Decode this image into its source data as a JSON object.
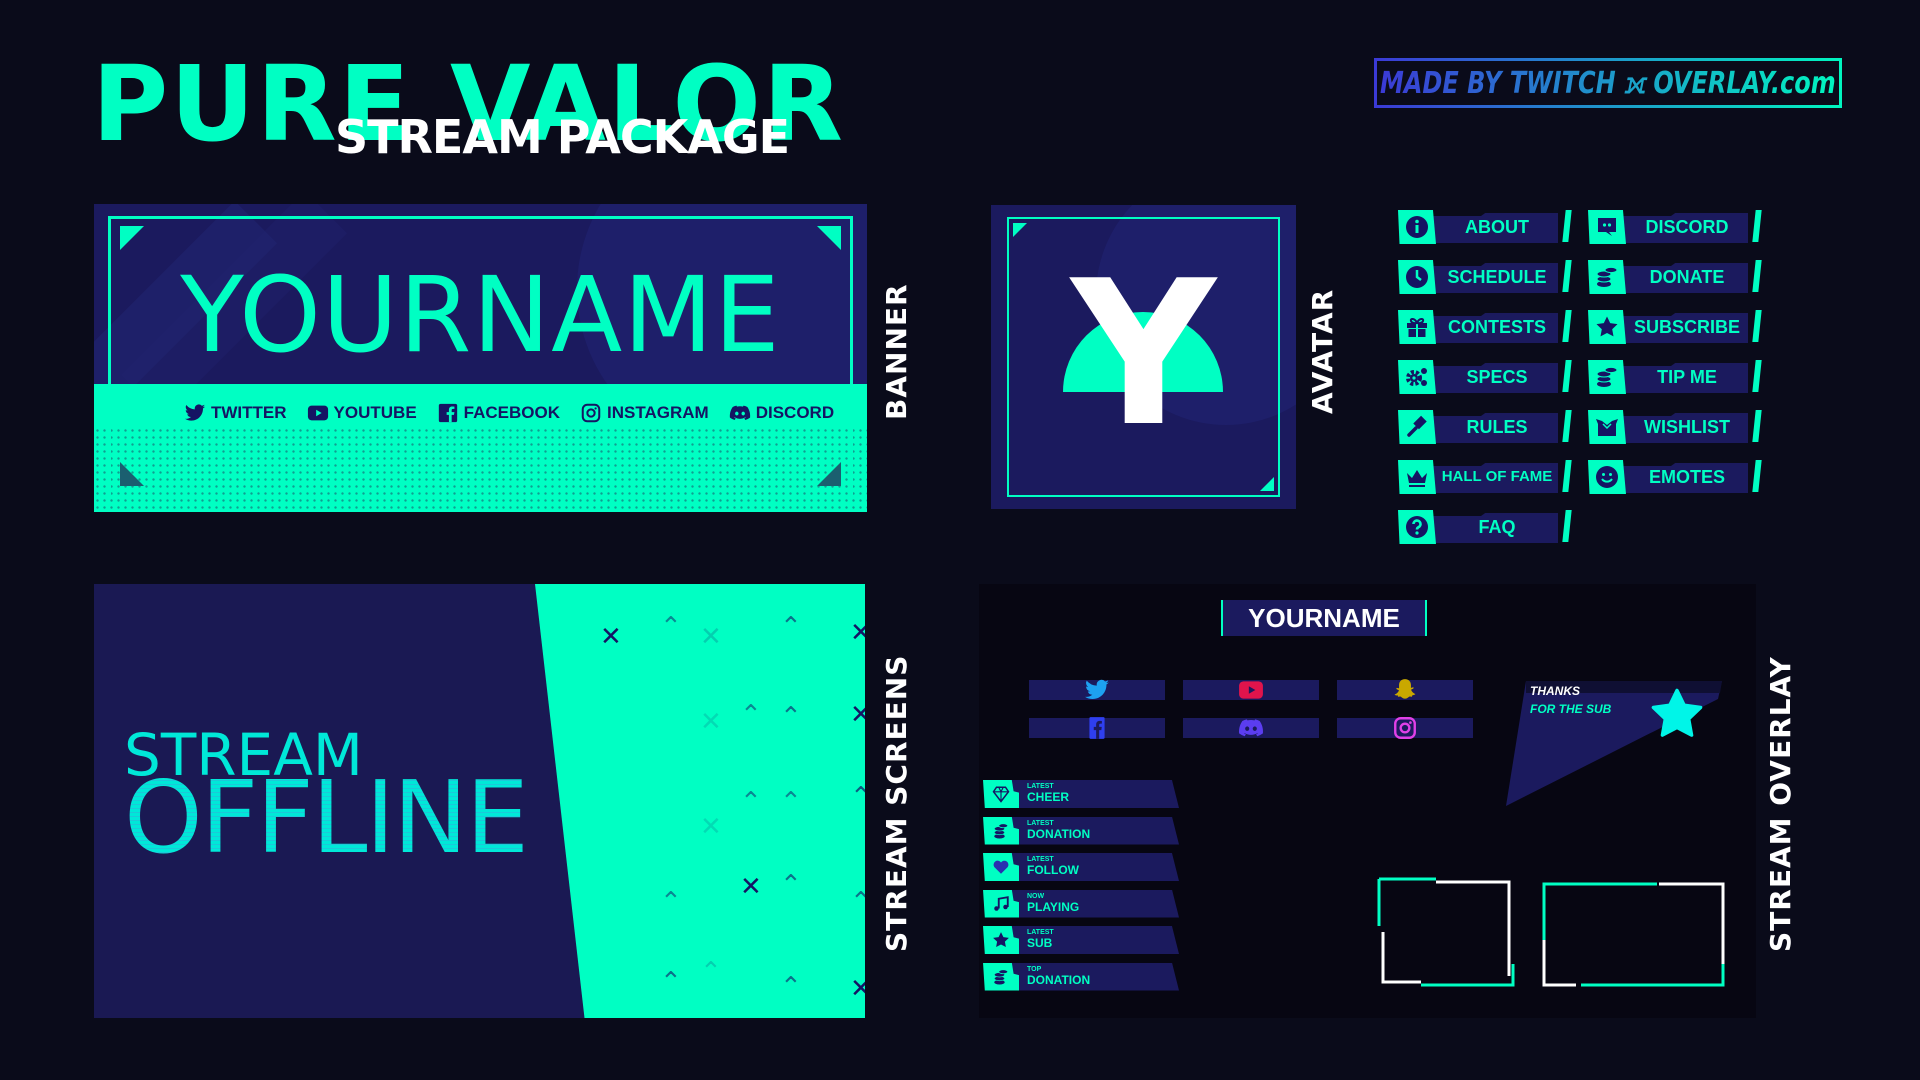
{
  "header": {
    "title": "PURE VALOR",
    "subtitle": "STREAM PACKAGE",
    "credit": "MADE BY TWITCH ⟗ OVERLAY.com"
  },
  "colors": {
    "accent": "#00ffc3",
    "navy": "#1b1a5e",
    "background": "#0a0b1a",
    "white": "#ffffff"
  },
  "section_labels": {
    "banner": "BANNER",
    "avatar": "AVATAR",
    "stream_screens": "STREAM SCREENS",
    "stream_overlay": "STREAM OVERLAY"
  },
  "banner": {
    "name": "YOURNAME",
    "socials": [
      {
        "icon": "twitter-icon",
        "label": "TWITTER"
      },
      {
        "icon": "youtube-icon",
        "label": "YOUTUBE"
      },
      {
        "icon": "facebook-icon",
        "label": "FACEBOOK"
      },
      {
        "icon": "instagram-icon",
        "label": "INSTAGRAM"
      },
      {
        "icon": "discord-icon",
        "label": "DISCORD"
      }
    ]
  },
  "avatar": {
    "letter": "Y"
  },
  "panels": {
    "left": [
      {
        "icon": "info-icon",
        "label": "ABOUT"
      },
      {
        "icon": "clock-icon",
        "label": "SCHEDULE"
      },
      {
        "icon": "gift-icon",
        "label": "CONTESTS"
      },
      {
        "icon": "gears-icon",
        "label": "SPECS"
      },
      {
        "icon": "gavel-icon",
        "label": "RULES"
      },
      {
        "icon": "crown-icon",
        "label": "HALL OF FAME"
      },
      {
        "icon": "question-icon",
        "label": "FAQ"
      }
    ],
    "right": [
      {
        "icon": "discord-icon",
        "label": "DISCORD"
      },
      {
        "icon": "coins-icon",
        "label": "DONATE"
      },
      {
        "icon": "star-icon",
        "label": "SUBSCRIBE"
      },
      {
        "icon": "coins-icon",
        "label": "TIP ME"
      },
      {
        "icon": "box-icon",
        "label": "WISHLIST"
      },
      {
        "icon": "smile-icon",
        "label": "EMOTES"
      }
    ]
  },
  "offline": {
    "line1": "STREAM",
    "line2": "OFFLINE"
  },
  "overlay": {
    "name": "YOURNAME",
    "socials": [
      {
        "icon": "twitter-icon",
        "color": "#1da1f2"
      },
      {
        "icon": "youtube-icon",
        "color": "#e0144c"
      },
      {
        "icon": "snapchat-icon",
        "color": "#c9a800"
      },
      {
        "icon": "facebook-icon",
        "color": "#2f3ff0"
      },
      {
        "icon": "discord-icon",
        "color": "#5b3df0"
      },
      {
        "icon": "instagram-icon",
        "color": "#e040e8"
      }
    ],
    "sub_alert": {
      "line1": "THANKS",
      "line2": "FOR THE SUB"
    },
    "alerts": [
      {
        "icon": "gem-icon",
        "small": "LATEST",
        "big": "CHEER"
      },
      {
        "icon": "coins-icon",
        "small": "LATEST",
        "big": "DONATION"
      },
      {
        "icon": "heart-icon",
        "small": "LATEST",
        "big": "FOLLOW"
      },
      {
        "icon": "music-icon",
        "small": "NOW",
        "big": "PLAYING"
      },
      {
        "icon": "star-icon",
        "small": "LATEST",
        "big": "SUB"
      },
      {
        "icon": "coins-icon",
        "small": "TOP",
        "big": "DONATION"
      }
    ]
  }
}
